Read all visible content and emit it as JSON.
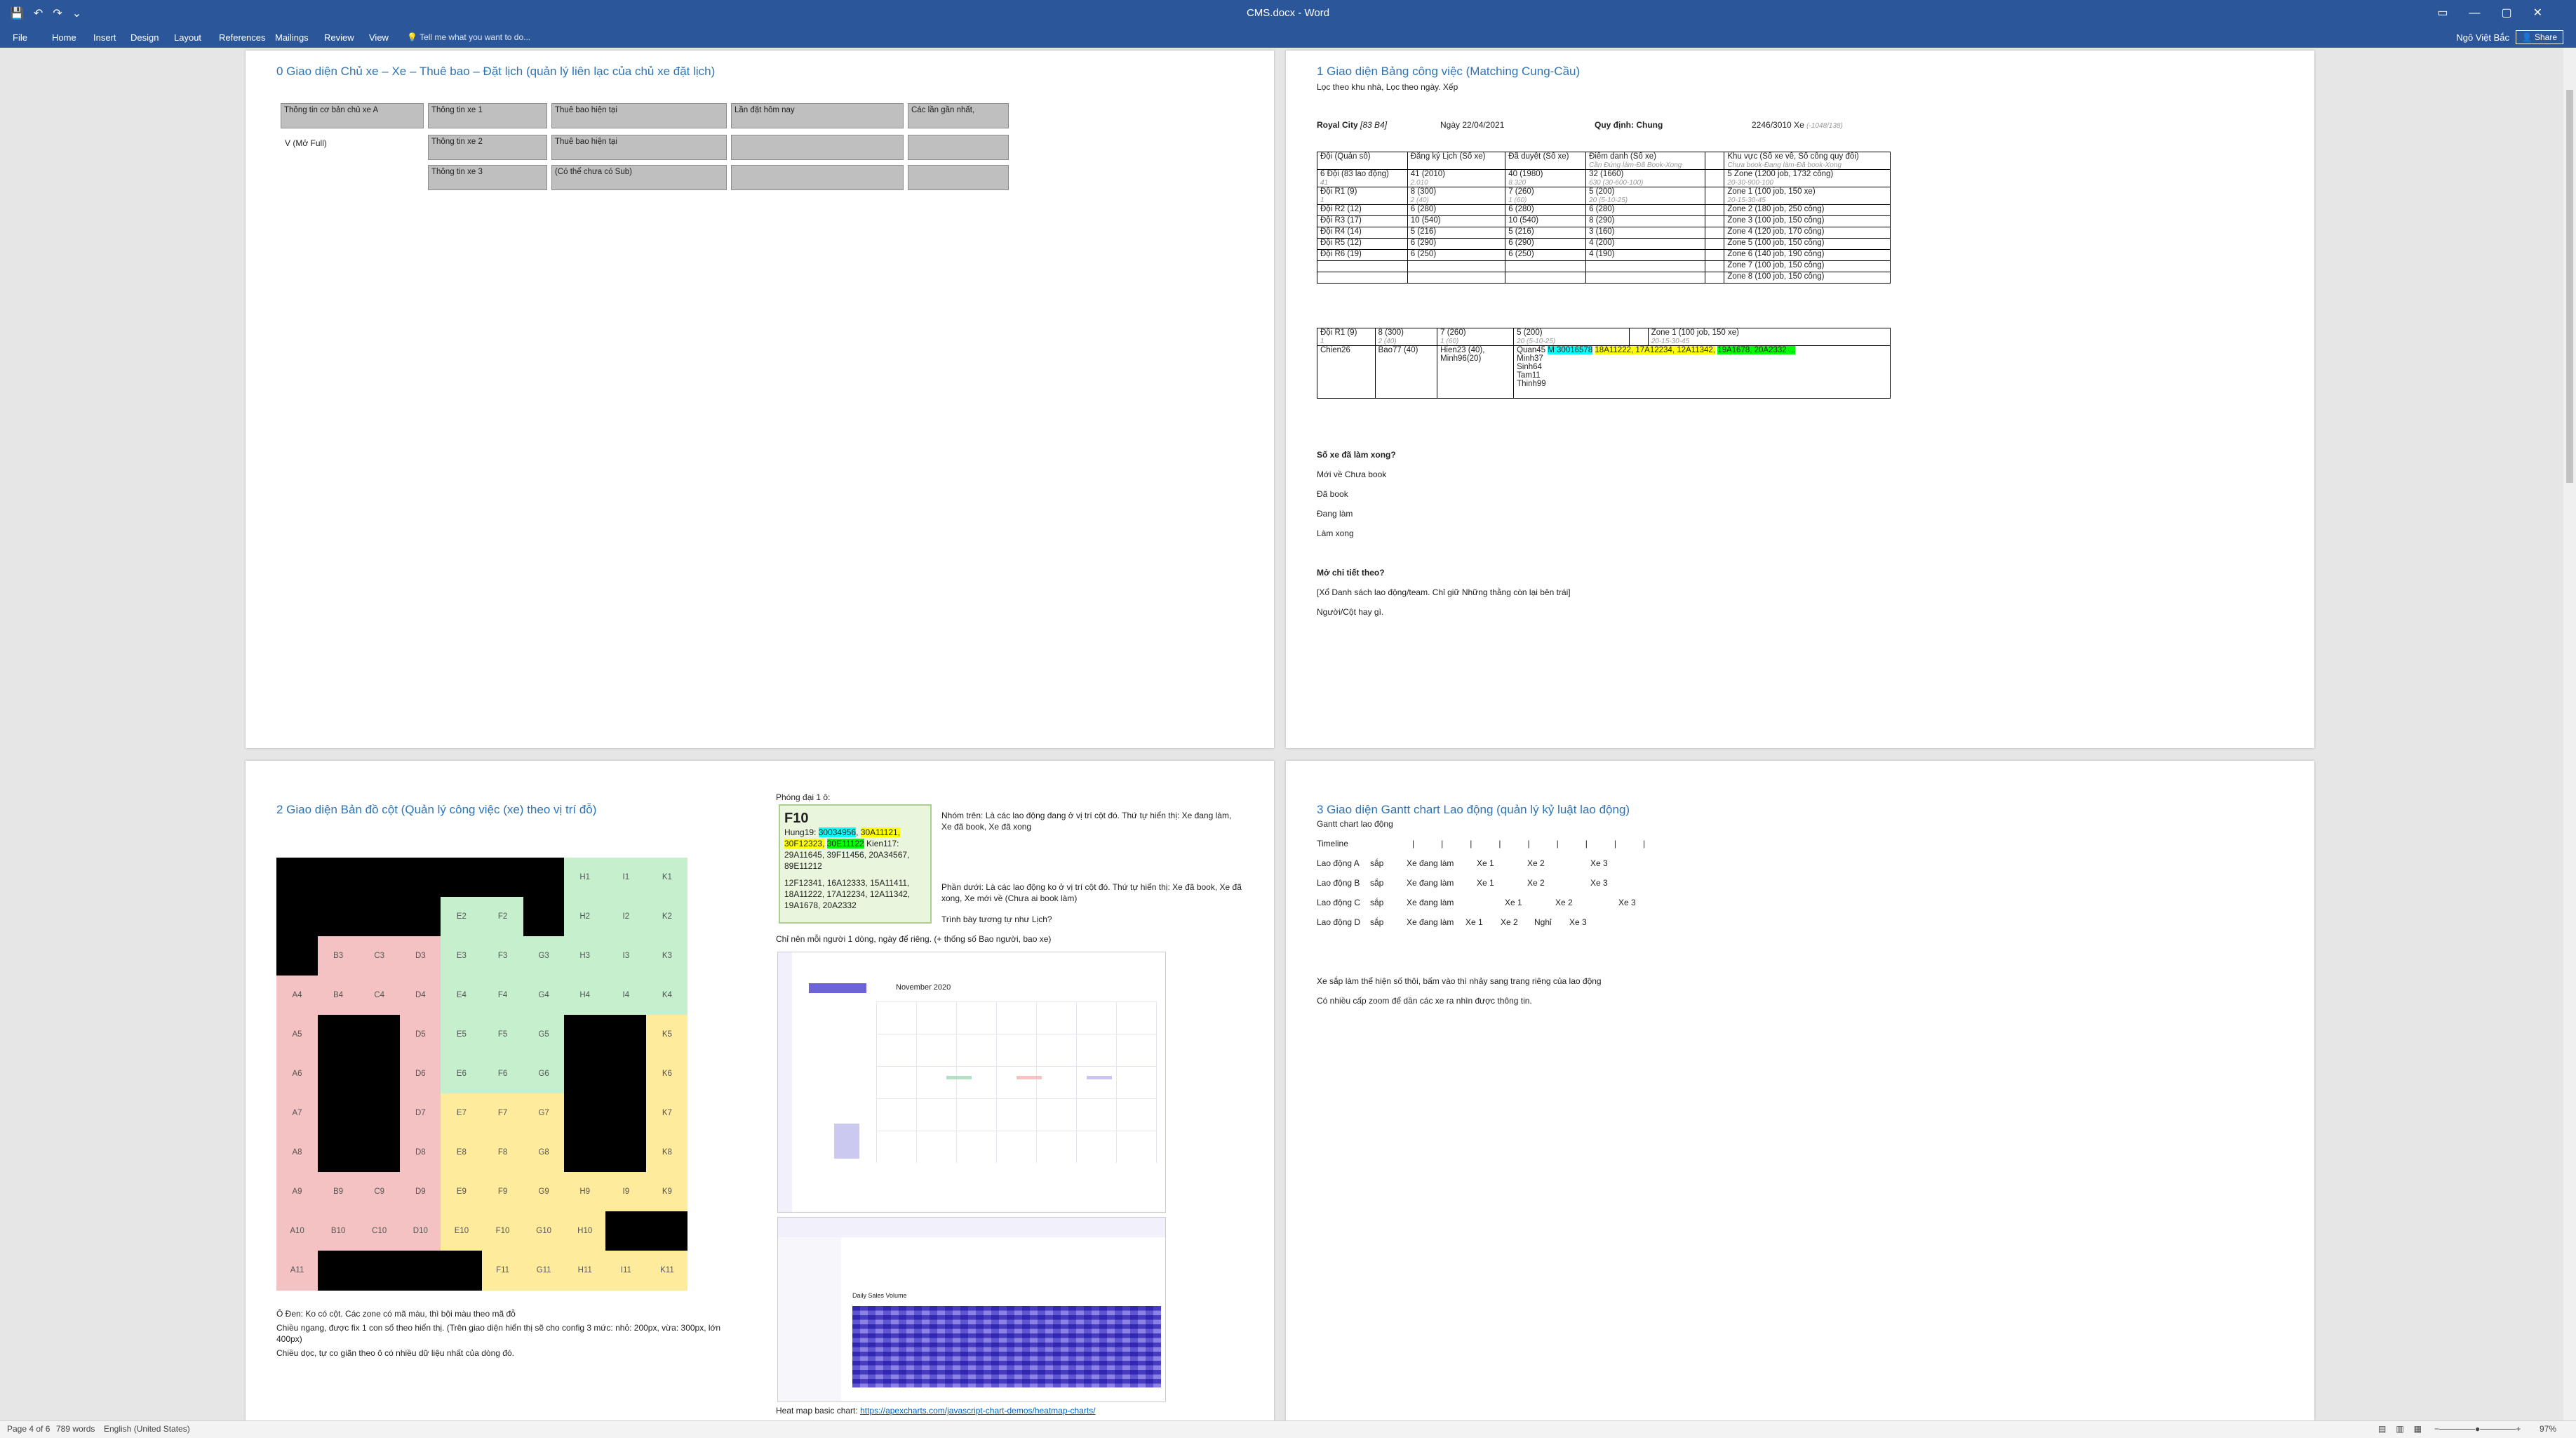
{
  "app": {
    "title": "CMS.docx - Word",
    "tabs": [
      "File",
      "Home",
      "Insert",
      "Design",
      "Layout",
      "References",
      "Mailings",
      "Review",
      "View"
    ],
    "tell_me": "Tell me what you want to do...",
    "user": "Ngô Việt Bắc",
    "share": "Share"
  },
  "page1": {
    "heading": "0 Giao diện Chủ xe – Xe – Thuê bao – Đặt lịch (quản lý liên lạc của chủ xe đặt lịch)",
    "owner_box": "Thông tin cơ bản chủ xe A",
    "v_label": "V (Mở Full)",
    "car1": "Thông tin xe 1",
    "car2": "Thông tin xe 2",
    "car3": "Thông tin xe 3",
    "sub1": "Thuê bao hiện tại",
    "sub2": "Thuê bao hiện tại",
    "sub3": "(Có thể chưa có Sub)",
    "booking": "Lần đặt hôm nay",
    "recent": "Các lần gần nhất,"
  },
  "page2": {
    "heading": "1 Giao diện Bảng công việc (Matching Cung-Cầu)",
    "subline": "Lọc theo khu nhà, Lọc theo ngày. Xếp",
    "info_city": "Royal City",
    "info_city_sub": "[83 B4]",
    "info_date": "Ngày 22/04/2021",
    "info_rule": "Quy định: Chung",
    "info_count": "2246/3010 Xe",
    "info_count_sub": "(-1048/138)",
    "table_header": [
      "Đội (Quản sô)",
      "Đăng ký Lịch (Số xe)",
      "Đã duyệt (Số xe)",
      "Điểm danh (Số xe)",
      "",
      "Khu vực (Số xe về, Số công quy đổi)"
    ],
    "table_header_sub": [
      "",
      "",
      "",
      "Cần Đúng làm-Đã Book-Xong",
      "",
      "Chưa book-Đang làm-Đã book-Xong"
    ],
    "rows": [
      [
        "6 Đội (83 lao động)",
        "41 (2010)",
        "40 (1980)",
        "32 (1660)",
        "",
        "5 Zone (1200 job, 1732 công)"
      ],
      [
        "Đội R1 (9)",
        "8 (300)",
        "7 (260)",
        "5 (200)",
        "",
        "Zone 1  (100 job, 150 xe)"
      ],
      [
        "Đội R2 (12)",
        "6 (280)",
        "6 (280)",
        "6 (280)",
        "",
        "Zone 2  (180 job, 250 công)"
      ],
      [
        "Đội R3 (17)",
        "10 (540)",
        "10 (540)",
        "8 (290)",
        "",
        "Zone 3  (100 job, 150 công)"
      ],
      [
        "Đội R4 (14)",
        "5 (216)",
        "5 (216)",
        "3 (160)",
        "",
        "Zone 4  (120 job, 170 công)"
      ],
      [
        "Đội R5 (12)",
        "6 (290)",
        "6 (290)",
        "4 (200)",
        "",
        "Zone 5  (100 job, 150 công)"
      ],
      [
        "Đội R6 (19)",
        "6 (250)",
        "6 (250)",
        "4 (190)",
        "",
        "Zone 6  (140 job, 190 công)"
      ],
      [
        "",
        "",
        "",
        "",
        "",
        "Zone 7  (100 job, 150 công)"
      ],
      [
        "",
        "",
        "",
        "",
        "",
        "Zone 8  (100 job, 150 công)"
      ]
    ],
    "row_subs": [
      [
        "41",
        "2.010",
        "8.320",
        "630 (30-600-100)",
        "",
        "20-30-900-100"
      ],
      [
        "1",
        "2 (40)",
        "1 (60)",
        "20 (5-10-25)",
        "",
        "20-15-30-45"
      ]
    ],
    "t2_r1": [
      "Đội R1 (9)",
      "8 (300)",
      "7 (260)",
      "5 (200)",
      "",
      "Zone 1  (100 job, 150 xe)"
    ],
    "t2_r1_sub": [
      "1",
      "2 (40)",
      "1 (60)",
      "20 (5-10-25)",
      "",
      "20-15-30-45"
    ],
    "t2_r2": [
      "Chien26",
      "Bao77 (40)",
      "Hien23 (40), Minh96(20)",
      "Quan45"
    ],
    "t2_plates": {
      "p1": "M 30016578",
      "p2": "18A11222, 17A12234, 12A11342,",
      "p3": "19A1678, 20A2332 ..."
    },
    "t2_names": [
      "Minh37",
      "Sinh64",
      "Tam11",
      "Thinh99"
    ],
    "q1": "Số xe đã làm xong?",
    "q1_items": [
      "Mới về Chưa book",
      "Đã book",
      "Đang làm",
      "Làm xong"
    ],
    "q2": "Mở chi tiết theo?",
    "q2_items": [
      "[Xổ Danh sách lao động/team. Chỉ giữ Những thằng còn lại bên trái]",
      "Người/Cột hay gì."
    ]
  },
  "page3": {
    "heading": "2 Giao diện Bản đồ cột (Quản lý công việc (xe) theo vị trí đỗ)",
    "grid_rows": [
      [
        "",
        "",
        "",
        "",
        "",
        "",
        "",
        "H1",
        "I1",
        "K1"
      ],
      [
        "",
        "",
        "",
        "",
        "E2",
        "F2",
        "",
        "H2",
        "I2",
        "K2"
      ],
      [
        "",
        "B3",
        "C3",
        "D3",
        "E3",
        "F3",
        "G3",
        "H3",
        "I3",
        "K3"
      ],
      [
        "A4",
        "B4",
        "C4",
        "D4",
        "E4",
        "F4",
        "G4",
        "H4",
        "I4",
        "K4"
      ],
      [
        "A5",
        "",
        "",
        "D5",
        "E5",
        "F5",
        "G5",
        "",
        "",
        "K5"
      ],
      [
        "A6",
        "",
        "",
        "D6",
        "E6",
        "F6",
        "G6",
        "",
        "",
        "K6"
      ],
      [
        "A7",
        "",
        "",
        "D7",
        "E7",
        "F7",
        "G7",
        "",
        "",
        "K7"
      ],
      [
        "A8",
        "",
        "",
        "D8",
        "E8",
        "F8",
        "G8",
        "",
        "",
        "K8"
      ],
      [
        "A9",
        "B9",
        "C9",
        "D9",
        "E9",
        "F9",
        "G9",
        "H9",
        "I9",
        "K9"
      ],
      [
        "A10",
        "B10",
        "C10",
        "D10",
        "E10",
        "F10",
        "G10",
        "H10",
        "",
        ""
      ],
      [
        "A11",
        "",
        "",
        "",
        "",
        "F11",
        "G11",
        "H11",
        "I11",
        "K11"
      ]
    ],
    "note1": "Ô Đen: Ko có cột. Các zone có mã màu, thì bội màu theo mã đỗ",
    "note2": "Chiều ngang, được fix 1 con số theo hiển thị. (Trên giao diện hiển thị sẽ cho config 3 mức: nhỏ: 200px, vừa: 300px, lớn 400px)",
    "note3": "Chiều dọc, tự co giãn theo ô có nhiều dữ liệu nhất của dòng đó.",
    "zoom_label": "Phóng đại 1 ô:",
    "f10_title": "F10",
    "f10_name": "Hung19:",
    "f10_p1": "30034956",
    "f10_p2": "30A11121,",
    "f10_p3": "30F12323,",
    "f10_p4": "30E11122",
    "f10_rest": " Kien117: 29A11645, 39F11456, 20A34567, 89E11212",
    "f10_lower": "12F12341, 16A12333, 15A11411, 18A11222, 17A12234, 12A11342, 19A1678, 20A2332",
    "desc_top": "Nhóm trên: Là các lao động đang ở vị trí cột đó. Thứ tự hiển thị: Xe đang làm, Xe đã book, Xe đã xong",
    "desc_bottom": "Phần dưới: Là các lao động ko ở vị trí cột đó. Thứ tự hiển thị: Xe đã book, Xe đã xong, Xe mới về (Chưa ai book làm)",
    "desc_same": "Trình bày tương tự như Lịch?",
    "only_one": "Chỉ nên mỗi người 1 dòng, ngày để riêng. (+ thống số Bao người, bao xe)",
    "calendar_month": "November 2020",
    "heatmap_title": "Daily Sales Volume",
    "heat_link_label": "Heat map basic chart:",
    "heat_link": "https://apexcharts.com/javascript-chart-demos/heatmap-charts/"
  },
  "page4": {
    "heading": "3 Giao diện Gantt chart Lao động (quản lý kỷ luật lao động)",
    "sub": "Gantt chart lao động",
    "timeline": "Timeline",
    "rows": [
      [
        "Lao động A",
        "sắp",
        "Xe đang làm",
        "Xe 1",
        "Xe 2",
        "Xe 3"
      ],
      [
        "Lao động B",
        "sắp",
        "Xe đang làm",
        "Xe 1",
        "Xe 2",
        "Xe 3"
      ],
      [
        "Lao động C",
        "sắp",
        "Xe đang làm",
        "Xe 1",
        "Xe 2",
        "Xe 3"
      ],
      [
        "Lao động D",
        "sắp",
        "Xe đang làm",
        "Xe 1",
        "Xe 2",
        "Nghỉ",
        "Xe 3"
      ]
    ],
    "note1": "Xe sắp làm thể hiện số thôi, bấm vào thì nhảy sang trang riêng của lao động",
    "note2": "Có nhiều cấp zoom để dần các xe ra nhìn được thông tin."
  },
  "status": {
    "page": "Page 4 of 6",
    "words": "789 words",
    "lang": "English (United States)",
    "zoom": "97%"
  },
  "colors": {
    "ribbon": "#2b579a",
    "heading": "#2e74b5",
    "pink": "#f4c2c2",
    "green": "#c6efce",
    "yellow": "#ffeb9c"
  }
}
